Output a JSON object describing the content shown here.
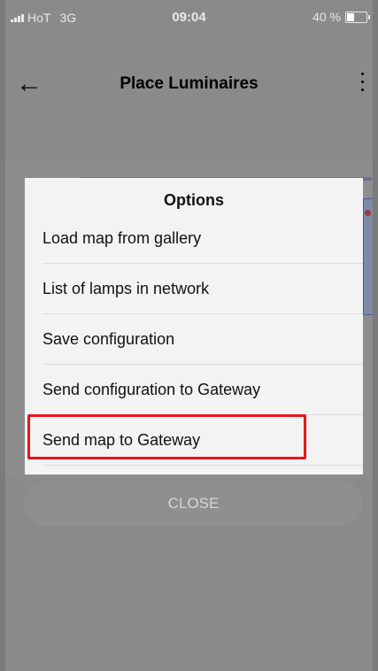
{
  "status_bar": {
    "carrier": "HoT",
    "network": "3G",
    "time": "09:04",
    "battery_text": "40 %",
    "battery_level": 0.4
  },
  "app_bar": {
    "title": "Place Luminaires",
    "back_icon": "back-arrow-icon",
    "more_icon": "more-vertical-icon"
  },
  "dialog": {
    "title": "Options",
    "options": [
      {
        "label": "Load map from gallery"
      },
      {
        "label": "List of lamps in network"
      },
      {
        "label": "Save configuration"
      },
      {
        "label": "Send configuration to Gateway"
      },
      {
        "label": "Send map to Gateway"
      }
    ],
    "highlighted_option": "Send map to Gateway"
  },
  "close_button": {
    "label": "CLOSE"
  },
  "colors": {
    "highlight": "#e8141c",
    "scrim": "#8a8a8a",
    "dialog_bg": "#f3f3f3"
  }
}
